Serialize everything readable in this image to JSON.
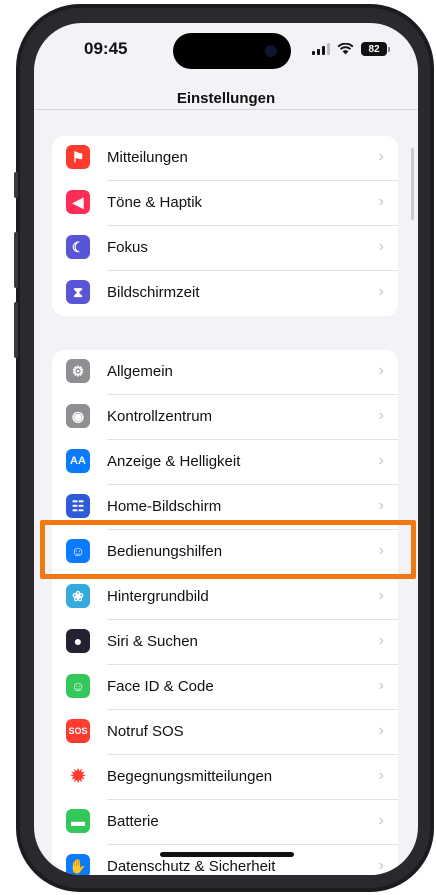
{
  "status": {
    "time": "09:45",
    "battery": "82"
  },
  "nav": {
    "title": "Einstellungen"
  },
  "group1": [
    {
      "label": "Mitteilungen",
      "icon": "notifications-icon",
      "color": "#ff3b30",
      "glyph": "⚑"
    },
    {
      "label": "Töne & Haptik",
      "icon": "sounds-icon",
      "color": "#ff2d55",
      "glyph": "◀"
    },
    {
      "label": "Fokus",
      "icon": "focus-moon-icon",
      "color": "#5856d6",
      "glyph": "☾"
    },
    {
      "label": "Bildschirmzeit",
      "icon": "screen-time-hourglass-icon",
      "color": "#5856d6",
      "glyph": "⧗"
    }
  ],
  "group2": [
    {
      "label": "Allgemein",
      "icon": "general-gear-icon",
      "color": "#8e8e93",
      "glyph": "⚙"
    },
    {
      "label": "Kontrollzentrum",
      "icon": "control-center-icon",
      "color": "#8e8e93",
      "glyph": "◉"
    },
    {
      "label": "Anzeige & Helligkeit",
      "icon": "display-brightness-icon",
      "color": "#0a7aff",
      "glyph": "AA"
    },
    {
      "label": "Home-Bildschirm",
      "icon": "home-screen-icon",
      "color": "#2f5bd8",
      "glyph": "☷"
    },
    {
      "label": "Bedienungshilfen",
      "icon": "accessibility-icon",
      "color": "#0a7aff",
      "glyph": "☺"
    },
    {
      "label": "Hintergrundbild",
      "icon": "wallpaper-icon",
      "color": "#35aadc",
      "glyph": "❀"
    },
    {
      "label": "Siri & Suchen",
      "icon": "siri-icon",
      "color": "#222233",
      "glyph": "●"
    },
    {
      "label": "Face ID & Code",
      "icon": "face-id-icon",
      "color": "#34c759",
      "glyph": "☺"
    },
    {
      "label": "Notruf SOS",
      "icon": "sos-icon",
      "color": "#ff3b30",
      "glyph": "SOS"
    },
    {
      "label": "Begegnungsmitteilungen",
      "icon": "exposure-notifications-icon",
      "color": "#ffffff",
      "glyph": "✹"
    },
    {
      "label": "Batterie",
      "icon": "battery-icon",
      "color": "#34c759",
      "glyph": "▬"
    },
    {
      "label": "Datenschutz & Sicherheit",
      "icon": "privacy-hand-icon",
      "color": "#0a7aff",
      "glyph": "✋"
    }
  ],
  "chevron": "›"
}
